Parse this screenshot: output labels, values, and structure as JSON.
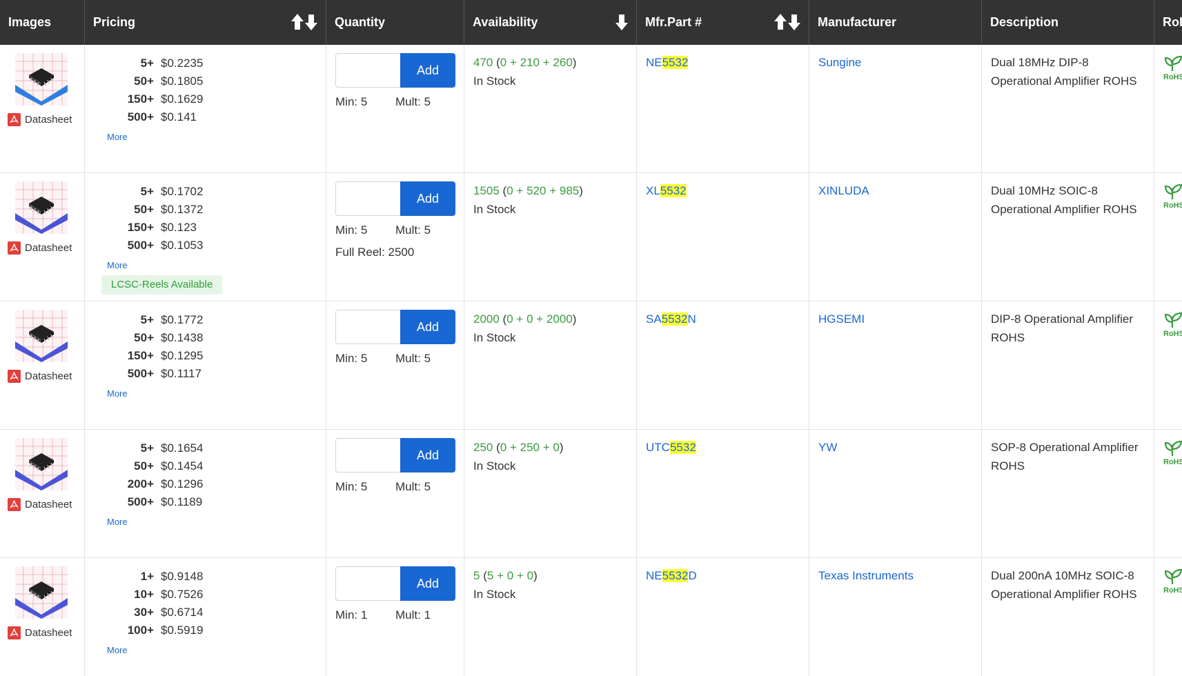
{
  "columns": {
    "images": "Images",
    "pricing": "Pricing",
    "quantity": "Quantity",
    "availability": "Availability",
    "mfr_part": "Mfr.Part #",
    "manufacturer": "Manufacturer",
    "description": "Description",
    "rohs": "RoH"
  },
  "labels": {
    "datasheet": "Datasheet",
    "more": "More",
    "add": "Add",
    "in_stock": "In Stock",
    "min_prefix": "Min: ",
    "mult_prefix": "Mult: ",
    "rohs_badge": "RoHS"
  },
  "colors": {
    "header_bg": "#333333",
    "link_blue": "#1967d2",
    "stock_green": "#3a9b3f",
    "highlight": "#ffff33",
    "reels_bg": "#e5f6e6"
  },
  "rows": [
    {
      "package_icon": "dip-chip-image",
      "tiers": [
        {
          "qty": "5+",
          "price": "$0.2235"
        },
        {
          "qty": "50+",
          "price": "$0.1805"
        },
        {
          "qty": "150+",
          "price": "$0.1629"
        },
        {
          "qty": "500+",
          "price": "$0.141"
        }
      ],
      "reels": "",
      "min": "5",
      "mult": "5",
      "full_reel": "",
      "stock_total": "470",
      "stock_a": "0",
      "stock_b": "210",
      "stock_c": "260",
      "part_pre": "NE",
      "part_hl": "5532",
      "part_post": "",
      "manufacturer": "Sungine",
      "description": "Dual 18MHz DIP-8 Operational Amplifier ROHS"
    },
    {
      "package_icon": "soic-chip-image",
      "tiers": [
        {
          "qty": "5+",
          "price": "$0.1702"
        },
        {
          "qty": "50+",
          "price": "$0.1372"
        },
        {
          "qty": "150+",
          "price": "$0.123"
        },
        {
          "qty": "500+",
          "price": "$0.1053"
        }
      ],
      "reels": "LCSC-Reels Available",
      "min": "5",
      "mult": "5",
      "full_reel": "Full Reel: 2500",
      "stock_total": "1505",
      "stock_a": "0",
      "stock_b": "520",
      "stock_c": "985",
      "part_pre": "XL",
      "part_hl": "5532",
      "part_post": "",
      "manufacturer": "XINLUDA",
      "description": "Dual 10MHz SOIC-8 Operational Amplifier ROHS"
    },
    {
      "package_icon": "soic-chip-image",
      "tiers": [
        {
          "qty": "5+",
          "price": "$0.1772"
        },
        {
          "qty": "50+",
          "price": "$0.1438"
        },
        {
          "qty": "150+",
          "price": "$0.1295"
        },
        {
          "qty": "500+",
          "price": "$0.1117"
        }
      ],
      "reels": "",
      "min": "5",
      "mult": "5",
      "full_reel": "",
      "stock_total": "2000",
      "stock_a": "0",
      "stock_b": "0",
      "stock_c": "2000",
      "part_pre": "SA",
      "part_hl": "5532",
      "part_post": "N",
      "manufacturer": "HGSEMI",
      "description": "DIP-8 Operational Amplifier ROHS"
    },
    {
      "package_icon": "soic-chip-image",
      "tiers": [
        {
          "qty": "5+",
          "price": "$0.1654"
        },
        {
          "qty": "50+",
          "price": "$0.1454"
        },
        {
          "qty": "200+",
          "price": "$0.1296"
        },
        {
          "qty": "500+",
          "price": "$0.1189"
        }
      ],
      "reels": "",
      "min": "5",
      "mult": "5",
      "full_reel": "",
      "stock_total": "250",
      "stock_a": "0",
      "stock_b": "250",
      "stock_c": "0",
      "part_pre": "UTC",
      "part_hl": "5532",
      "part_post": "",
      "manufacturer": "YW",
      "description": "SOP-8 Operational Amplifier ROHS"
    },
    {
      "package_icon": "soic-chip-image",
      "tiers": [
        {
          "qty": "1+",
          "price": "$0.9148"
        },
        {
          "qty": "10+",
          "price": "$0.7526"
        },
        {
          "qty": "30+",
          "price": "$0.6714"
        },
        {
          "qty": "100+",
          "price": "$0.5919"
        }
      ],
      "reels": "",
      "min": "1",
      "mult": "1",
      "full_reel": "",
      "stock_total": "5",
      "stock_a": "5",
      "stock_b": "0",
      "stock_c": "0",
      "part_pre": "NE",
      "part_hl": "5532",
      "part_post": "D",
      "manufacturer": "Texas Instruments",
      "description": "Dual 200nA 10MHz SOIC-8 Operational Amplifier ROHS"
    }
  ]
}
